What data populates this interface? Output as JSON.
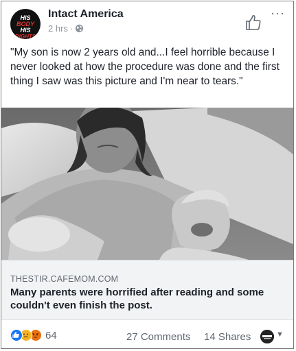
{
  "post": {
    "page_name": "Intact America",
    "time": "2 hrs",
    "separator": "·",
    "avatar_text": [
      "HIS",
      "BODY",
      "HIS",
      "RIGHTS"
    ],
    "text": "\"My son is now 2 years old and...I feel horrible because I never looked at how the procedure was done and the first thing I saw was this picture and I'm near to tears.\"",
    "more_label": "···"
  },
  "link": {
    "domain": "THESTIR.CAFEMOM.COM",
    "headline": "Many parents were horrified after reading and some couldn't even finish the post."
  },
  "footer": {
    "reaction_icons": [
      "like-icon",
      "sad-icon",
      "angry-icon"
    ],
    "reaction_count": "64",
    "comments": "27 Comments",
    "shares": "14 Shares",
    "caret": "▼"
  },
  "colors": {
    "like": "#1877f2",
    "sad": "#f7b125",
    "angry": "#e9710f",
    "link_bg": "#f2f3f5",
    "text": "#1d2129",
    "meta": "#90949c"
  }
}
